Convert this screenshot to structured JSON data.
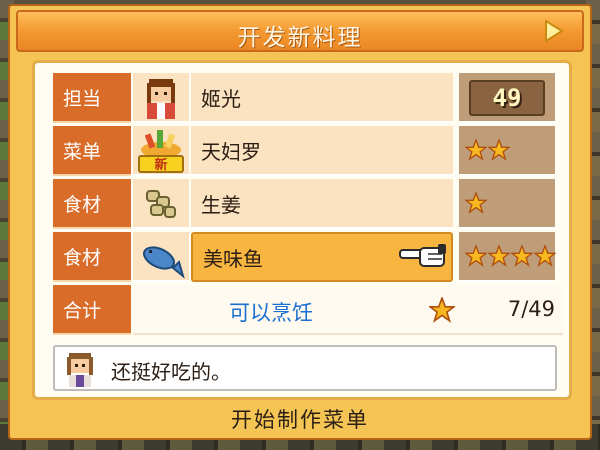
{
  "title": "开发新料理",
  "rows": [
    {
      "label": "担当",
      "value": "姬光",
      "icon": "chef-portrait-icon",
      "rank": "49"
    },
    {
      "label": "菜单",
      "value": "天妇罗",
      "icon": "tempura-dish-icon",
      "badge": "新",
      "stars": 2
    },
    {
      "label": "食材",
      "value": "生姜",
      "icon": "ginger-icon",
      "stars": 1
    },
    {
      "label": "食材",
      "value": "美味鱼",
      "icon": "fish-icon",
      "stars": 4,
      "selected": true
    }
  ],
  "total": {
    "label": "合计",
    "status": "可以烹饪",
    "score": "7/49"
  },
  "comment": {
    "text": "还挺好吃的。",
    "avatar": "staff-avatar-icon"
  },
  "action": {
    "label": "开始制作菜单"
  },
  "colors": {
    "accent": "#f49a32",
    "label_bg": "#d86c28",
    "status_blue": "#1b6fd0",
    "star": "#f8b820"
  }
}
